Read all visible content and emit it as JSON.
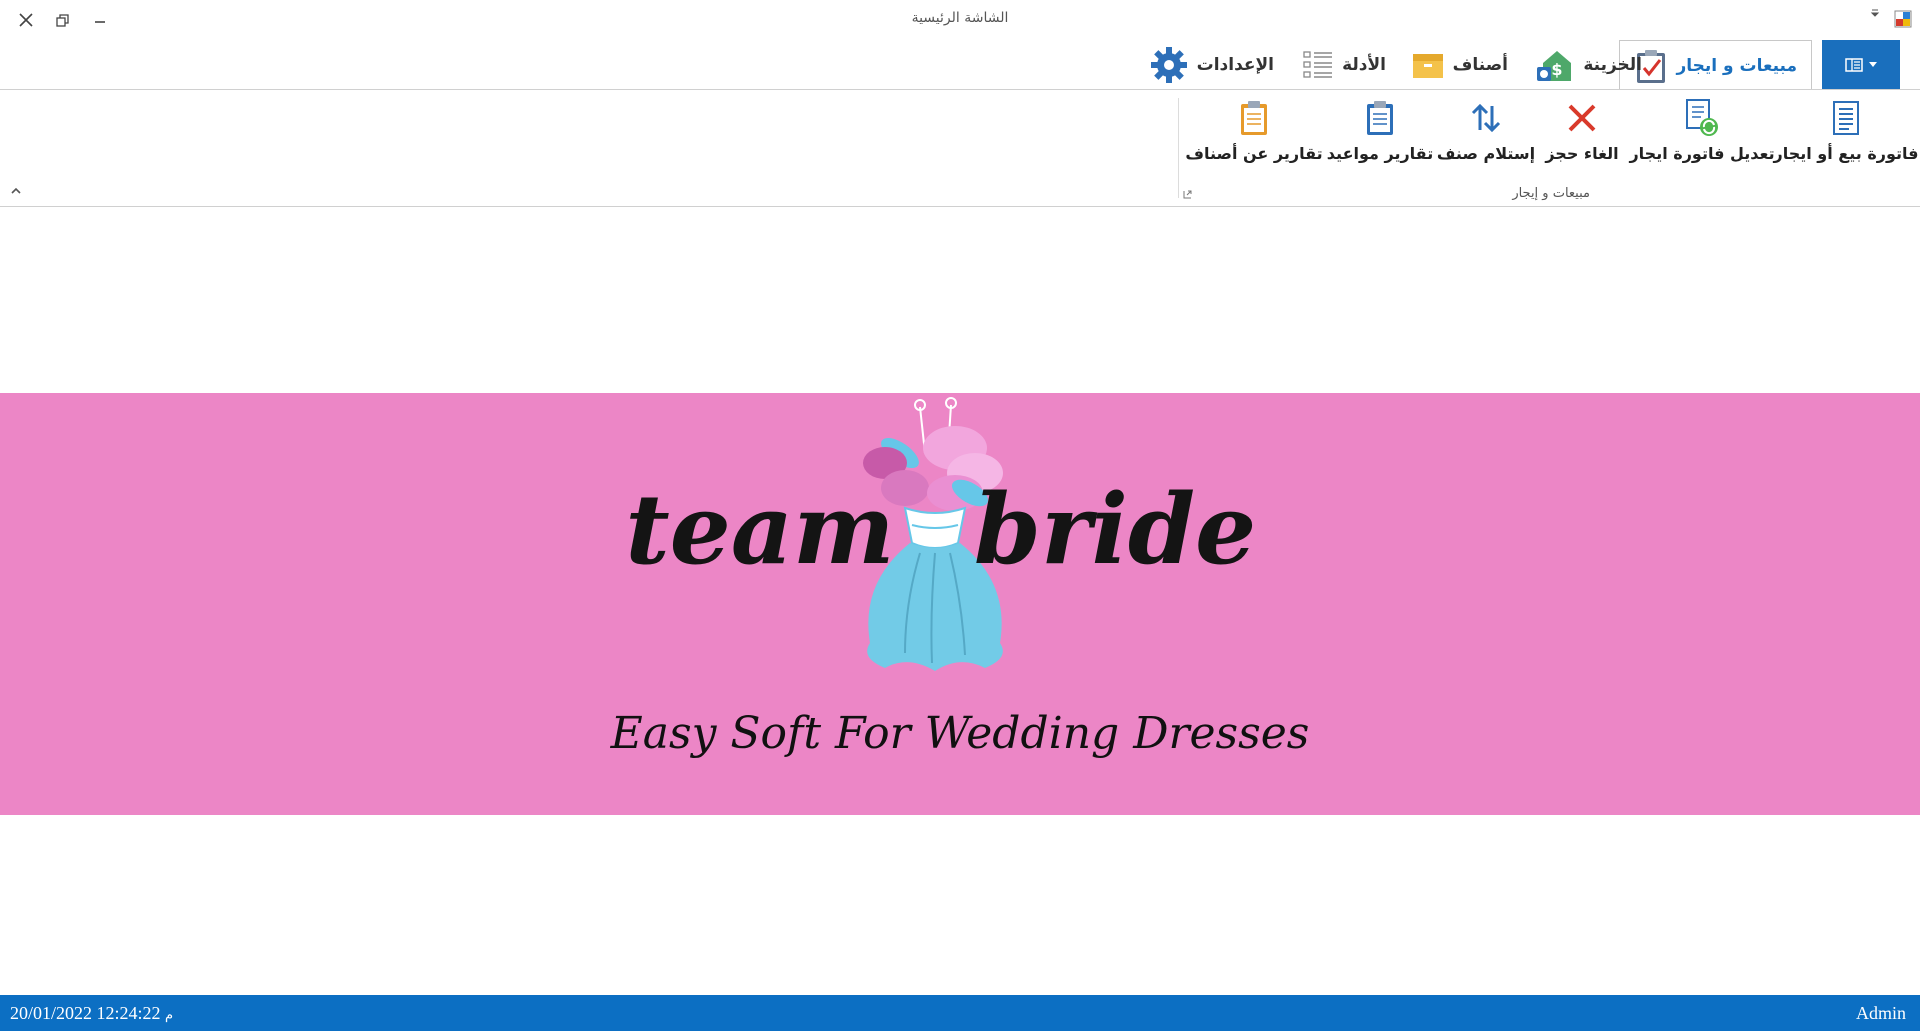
{
  "window": {
    "title": "الشاشة الرئيسية"
  },
  "tabs": [
    {
      "label": "مبيعات و ايجار",
      "icon": "clipboard-check-icon",
      "active": true
    },
    {
      "label": "الخزينة",
      "icon": "money-house-icon",
      "active": false
    },
    {
      "label": "أصناف",
      "icon": "box-icon",
      "active": false
    },
    {
      "label": "الأدلة",
      "icon": "list-icon",
      "active": false
    },
    {
      "label": "الإعدادات",
      "icon": "gear-icon",
      "active": false
    }
  ],
  "ribbon": {
    "group_label": "مبيعات و إيجار",
    "buttons": [
      {
        "label": "فاتورة بيع أو ايجار",
        "icon": "invoice-icon"
      },
      {
        "label": "تعديل فاتورة ايجار",
        "icon": "edit-invoice-icon"
      },
      {
        "label": "الغاء حجز",
        "icon": "cancel-icon"
      },
      {
        "label": "إستلام صنف",
        "icon": "transfer-arrows-icon"
      },
      {
        "label": "تقارير مواعيد",
        "icon": "report-clipboard-icon"
      },
      {
        "label": "تقارير عن أصناف",
        "icon": "report-items-icon"
      }
    ]
  },
  "banner": {
    "logo_text": "team bride",
    "tagline": "Easy Soft For Wedding Dresses",
    "background": "#ec86c6"
  },
  "status": {
    "datetime": "12:24:22 20/01/2022",
    "suffix": "م",
    "user": "Admin"
  },
  "colors": {
    "accent": "#1a6fbd",
    "statusbar": "#0c6fc3"
  }
}
